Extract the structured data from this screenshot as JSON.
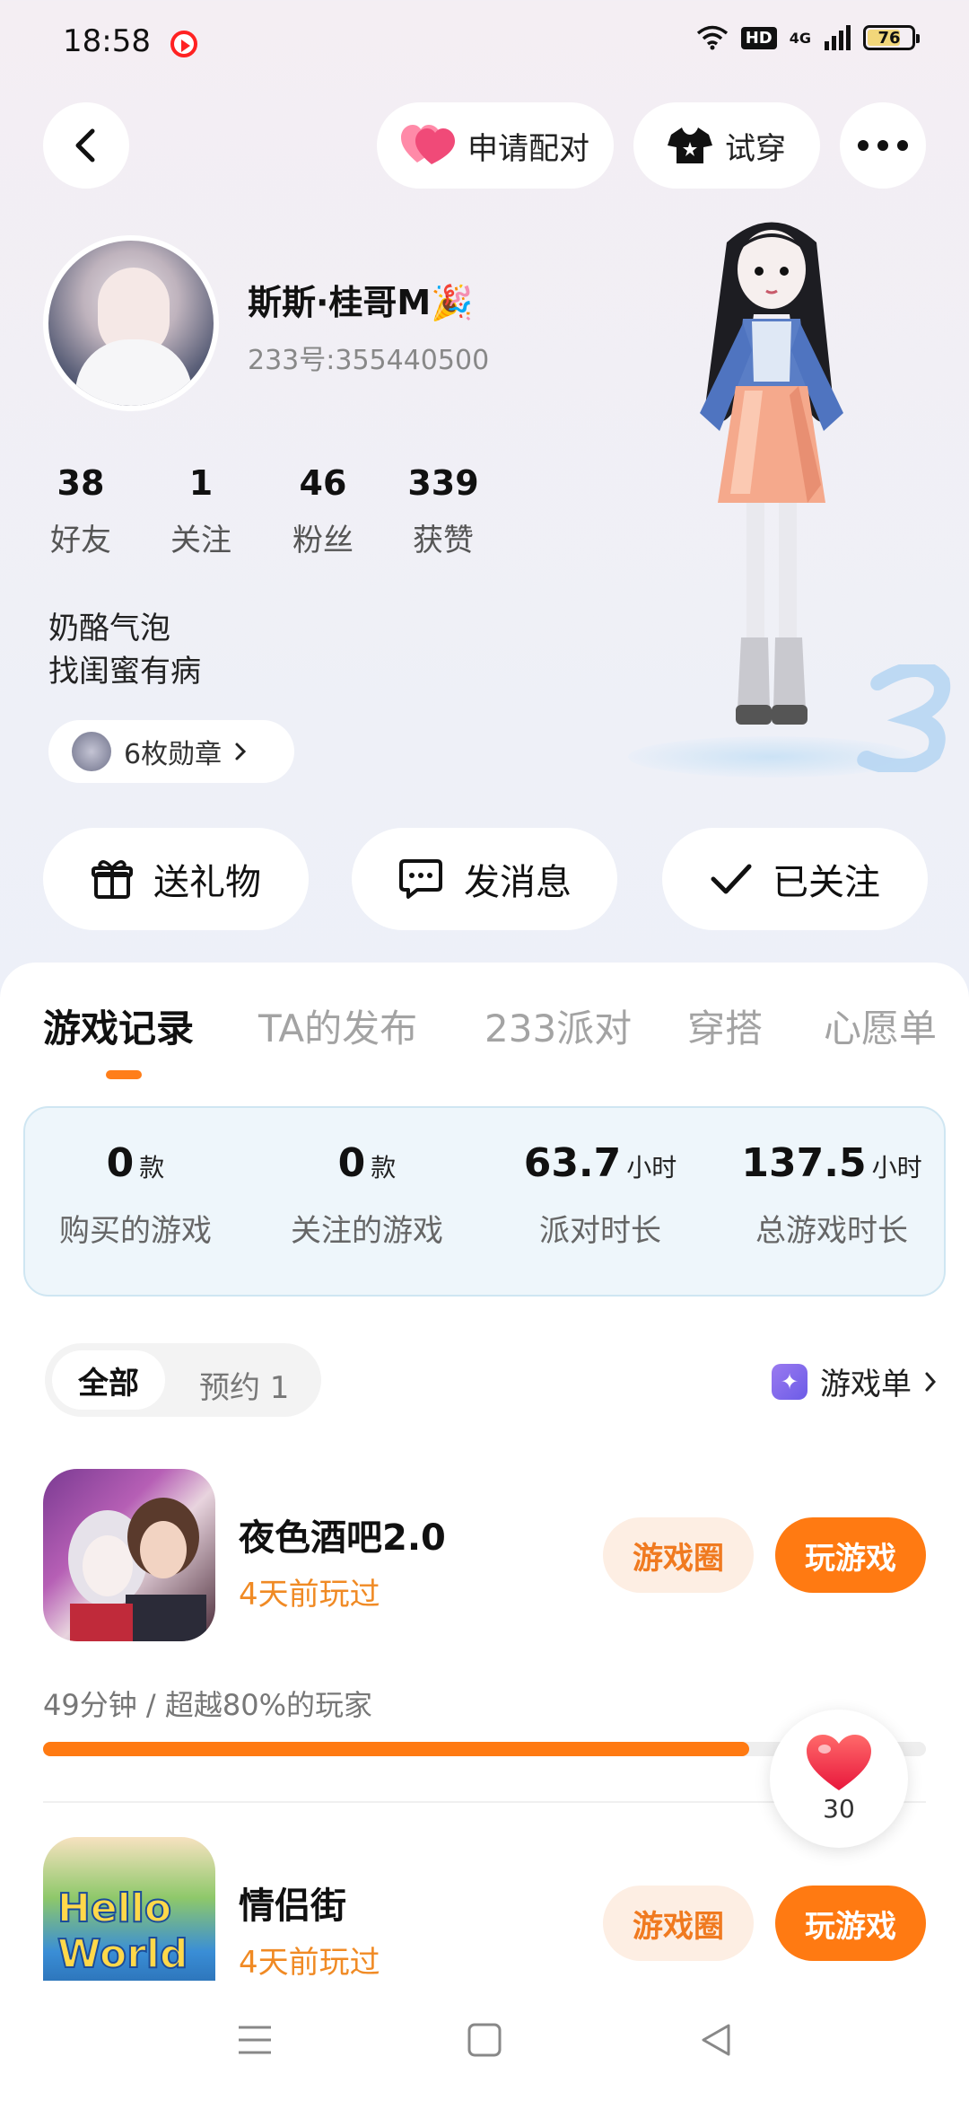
{
  "status_bar": {
    "time": "18:58",
    "network": "4G",
    "hd": "HD",
    "battery": "76",
    "icons": [
      "screen-record-icon",
      "wifi-icon",
      "signal-icon",
      "battery-icon"
    ]
  },
  "header": {
    "match_label": "申请配对",
    "try_on_label": "试穿"
  },
  "profile": {
    "name": "斯斯·桂哥M🎉",
    "uid": "233号:355440500",
    "stats": [
      {
        "num": "38",
        "label": "好友"
      },
      {
        "num": "1",
        "label": "关注"
      },
      {
        "num": "46",
        "label": "粉丝"
      },
      {
        "num": "339",
        "label": "获赞"
      }
    ],
    "bio_line1": "奶酪气泡",
    "bio_line2": "找闺蜜有病",
    "medal_label": "6枚勋章"
  },
  "actions": {
    "gift": "送礼物",
    "message": "发消息",
    "followed": "已关注"
  },
  "tabs": [
    "游戏记录",
    "TA的发布",
    "233派对",
    "穿搭",
    "心愿单"
  ],
  "summary": [
    {
      "value": "0",
      "unit": "款",
      "label": "购买的游戏"
    },
    {
      "value": "0",
      "unit": "款",
      "label": "关注的游戏"
    },
    {
      "value": "63.7",
      "unit": "小时",
      "label": "派对时长"
    },
    {
      "value": "137.5",
      "unit": "小时",
      "label": "总游戏时长"
    }
  ],
  "filter": {
    "all": "全部",
    "reserved": "预约 1",
    "game_list": "游戏单"
  },
  "games": [
    {
      "title": "夜色酒吧2.0",
      "played": "4天前玩过",
      "circle_btn": "游戏圈",
      "play_btn": "玩游戏",
      "meta": "49分钟 / 超越80%的玩家",
      "progress": 0.8
    },
    {
      "title": "情侣街",
      "played": "4天前玩过",
      "circle_btn": "游戏圈",
      "play_btn": "玩游戏",
      "icon_text": "Hello World"
    }
  ],
  "like": {
    "count": "30"
  },
  "colors": {
    "accent": "#ff7a12",
    "accent_light": "#fdeee3",
    "played": "#f08a24"
  }
}
